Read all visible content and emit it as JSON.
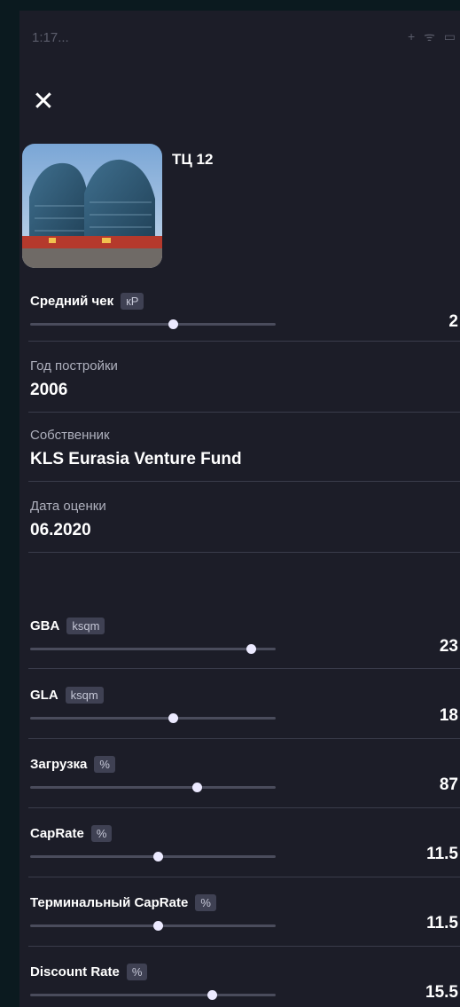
{
  "status": {
    "time": "1:17...",
    "icons": "+ ᯤ ▭"
  },
  "header": {
    "close_glyph": "✕",
    "title": "ТЦ 12"
  },
  "avg_check": {
    "label": "Средний чек",
    "unit": "кР",
    "value": "2",
    "level": 0.58
  },
  "info": [
    {
      "label": "Год постройки",
      "value": "2006"
    },
    {
      "label": "Собственник",
      "value": "KLS Eurasia Venture Fund"
    },
    {
      "label": "Дата оценки",
      "value": "06.2020"
    }
  ],
  "metrics": [
    {
      "label": "GBA",
      "unit": "ksqm",
      "value": "23",
      "level": 0.9
    },
    {
      "label": "GLA",
      "unit": "ksqm",
      "value": "18",
      "level": 0.58
    },
    {
      "label": "Загрузка",
      "unit": "%",
      "value": "87",
      "level": 0.68
    },
    {
      "label": "CapRate",
      "unit": "%",
      "value": "11.5",
      "level": 0.52
    },
    {
      "label": "Терминальный CapRate",
      "unit": "%",
      "value": "11.5",
      "level": 0.52
    },
    {
      "label": "Discount Rate",
      "unit": "%",
      "value": "15.5",
      "level": 0.74
    }
  ],
  "colors": {
    "background": "#1c1d28",
    "badge": "#3f4153",
    "track": "#4a4c5c",
    "thumb": "#eceaff"
  }
}
